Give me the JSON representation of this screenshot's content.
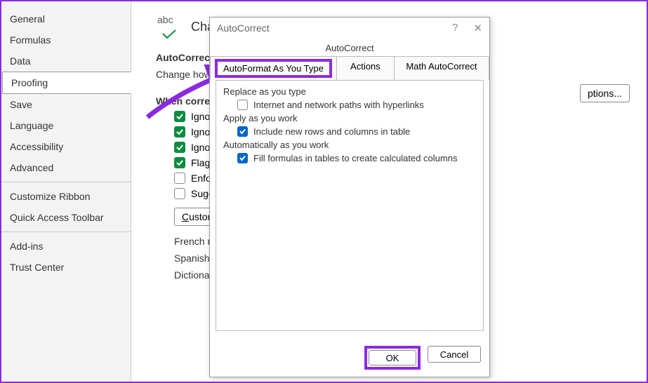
{
  "sidebar": {
    "items": [
      "General",
      "Formulas",
      "Data",
      "Proofing",
      "Save",
      "Language",
      "Accessibility",
      "Advanced"
    ],
    "selectedIndex": 3,
    "groups": {
      "customize": [
        "Customize Ribbon",
        "Quick Access Toolbar"
      ],
      "addins": [
        "Add-ins",
        "Trust Center"
      ]
    }
  },
  "main": {
    "heading": "Chan",
    "abc_label": "abc",
    "section1": "AutoCorrect o",
    "line1": "Change how",
    "section2": "When corre",
    "right_btn": "ptions...",
    "checks": [
      {
        "label": "Ignore w",
        "checked": true
      },
      {
        "label": "Ignore w",
        "checked": true
      },
      {
        "label": "Ignore I",
        "checked": true
      },
      {
        "label": "Flag repe",
        "checked": true
      },
      {
        "label": "Enforce a",
        "checked": false
      },
      {
        "label": "Suggest f",
        "checked": false
      }
    ],
    "custom_btn": "Custom Di",
    "french": "French mode",
    "spanish": "Spanish mo",
    "dict": "Dictionary la"
  },
  "dialog": {
    "title": "AutoCorrect",
    "help": "?",
    "close": "✕",
    "tabs": {
      "row1": "AutoCorrect",
      "row2": [
        "AutoFormat As You Type",
        "Actions",
        "Math AutoCorrect"
      ]
    },
    "groups": [
      {
        "label": "Replace as you type",
        "items": [
          {
            "label": "Internet and network paths with hyperlinks",
            "checked": false
          }
        ]
      },
      {
        "label": "Apply as you work",
        "items": [
          {
            "label": "Include new rows and columns in table",
            "checked": true
          }
        ]
      },
      {
        "label": "Automatically as you work",
        "items": [
          {
            "label": "Fill formulas in tables to create calculated columns",
            "checked": true
          }
        ]
      }
    ],
    "buttons": {
      "ok": "OK",
      "cancel": "Cancel"
    }
  }
}
